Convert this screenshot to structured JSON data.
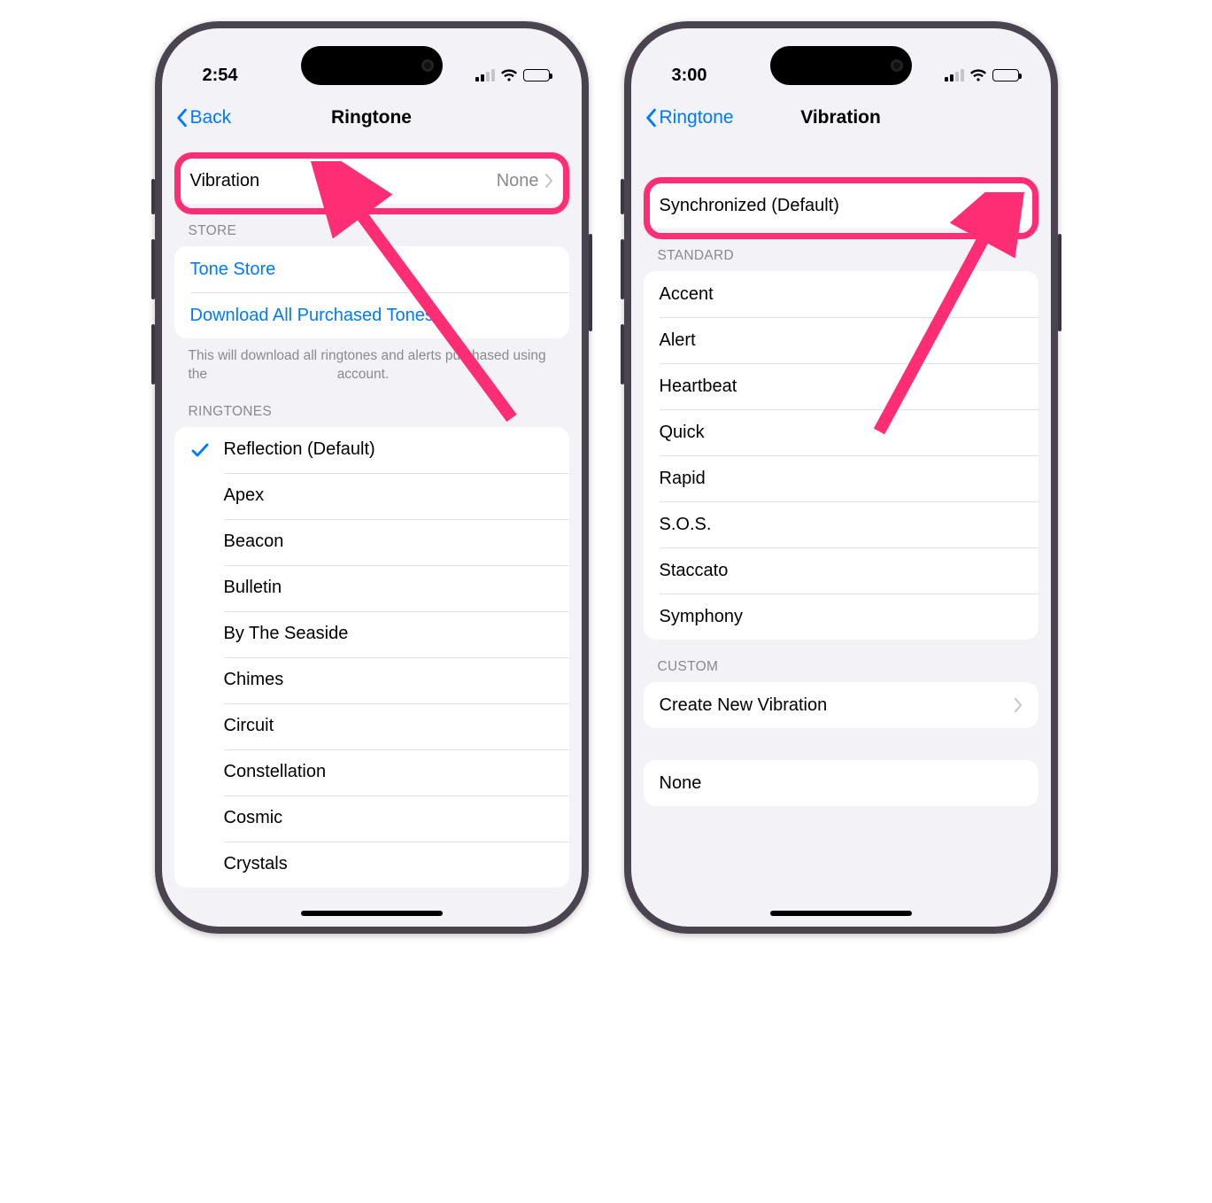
{
  "left_phone": {
    "time": "2:54",
    "nav": {
      "back_label": "Back",
      "title": "Ringtone"
    },
    "vibration_row": {
      "label": "Vibration",
      "value": "None"
    },
    "store": {
      "header": "STORE",
      "tone_store": "Tone Store",
      "download_all": "Download All Purchased Tones",
      "footer_a": "This will download all ringtones and alerts purchased using the",
      "footer_b": "account."
    },
    "ringtones_header": "RINGTONES",
    "ringtones": [
      {
        "label": "Reflection (Default)",
        "selected": true
      },
      {
        "label": "Apex"
      },
      {
        "label": "Beacon"
      },
      {
        "label": "Bulletin"
      },
      {
        "label": "By The Seaside"
      },
      {
        "label": "Chimes"
      },
      {
        "label": "Circuit"
      },
      {
        "label": "Constellation"
      },
      {
        "label": "Cosmic"
      },
      {
        "label": "Crystals"
      }
    ]
  },
  "right_phone": {
    "time": "3:00",
    "nav": {
      "back_label": "Ringtone",
      "title": "Vibration"
    },
    "default_row": {
      "label": "Synchronized (Default)",
      "selected": true
    },
    "standard_header": "STANDARD",
    "standard": [
      {
        "label": "Accent"
      },
      {
        "label": "Alert"
      },
      {
        "label": "Heartbeat"
      },
      {
        "label": "Quick"
      },
      {
        "label": "Rapid"
      },
      {
        "label": "S.O.S."
      },
      {
        "label": "Staccato"
      },
      {
        "label": "Symphony"
      }
    ],
    "custom_header": "CUSTOM",
    "custom_create": "Create New Vibration",
    "none_label": "None"
  },
  "colors": {
    "link": "#007aff",
    "callout": "#ff2d73"
  }
}
